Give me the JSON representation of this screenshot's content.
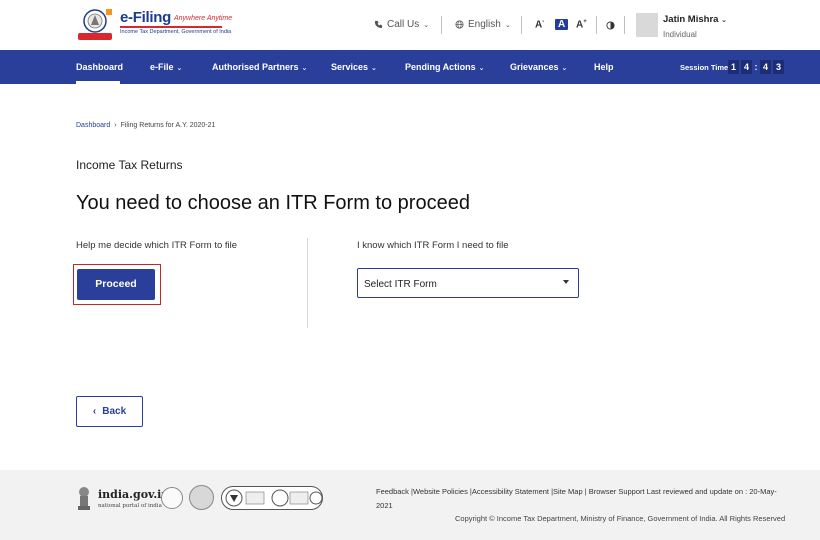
{
  "header": {
    "logo_title": "e-Filing",
    "logo_tagline": "Anywhere Anytime",
    "logo_subtitle": "Income Tax Department, Government of India",
    "call_us": "Call Us",
    "language": "English",
    "font_decrease": "A",
    "font_normal": "A",
    "font_increase": "A",
    "user_name": "Jatin Mishra",
    "user_role": "Individual"
  },
  "nav": {
    "items": [
      {
        "label": "Dashboard"
      },
      {
        "label": "e-File"
      },
      {
        "label": "Authorised Partners"
      },
      {
        "label": "Services"
      },
      {
        "label": "Pending Actions"
      },
      {
        "label": "Grievances"
      },
      {
        "label": "Help"
      }
    ],
    "session_label": "Session Time",
    "session_digits": [
      "1",
      "4",
      "4",
      "3"
    ]
  },
  "breadcrumb": {
    "home": "Dashboard",
    "separator": "›",
    "current": "Filing Returns for A.Y. 2020-21"
  },
  "main": {
    "section_title": "Income Tax Returns",
    "heading": "You need to choose an ITR Form to proceed",
    "left_label": "Help me decide which ITR Form to file",
    "proceed_label": "Proceed",
    "right_label": "I know which ITR Form I need to file",
    "select_value": "Select ITR Form",
    "back_label": "Back"
  },
  "footer": {
    "india_title": "india.gov.in",
    "india_subtitle": "national portal of india",
    "links": "Feedback |Website Policies |Accessibility Statement |Site Map | Browser Support   Last reviewed and update on : 20-May-2021",
    "copyright": "Copyright © Income Tax Department, Ministry of Finance, Government of India. All Rights Reserved"
  },
  "colors": {
    "nav_bg": "#2a3f9a",
    "primary": "#2a3f9a",
    "highlight": "#c0282b",
    "footer_bg": "#f2f2f2"
  }
}
